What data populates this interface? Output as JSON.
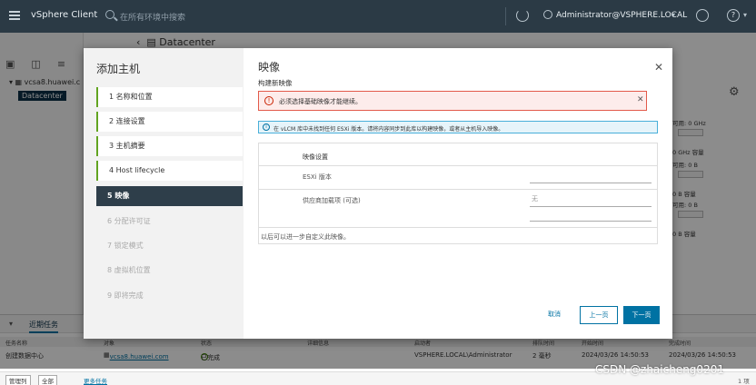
{
  "topbar": {
    "app_title": "vSphere Client",
    "search_placeholder": "在所有环境中搜索",
    "user": "Administrator@VSPHERE.LOCAL"
  },
  "background": {
    "header_title": "Datacenter",
    "tree_host": "vcsa8.huawei.c",
    "tree_datacenter": "Datacenter",
    "right_panel": {
      "cpu_free": "可用: 0 GHz",
      "cpu_capacity": "0 GHz 容量",
      "mem_free": "可用: 0 B",
      "mem_capacity": "0 B 容量",
      "storage_free": "可用: 0 B",
      "storage_capacity": "0 B 容量"
    }
  },
  "tasks": {
    "tab_recent": "近期任务",
    "columns": [
      "任务名称",
      "对象",
      "状态",
      "详细信息",
      "启动者",
      "排队时间",
      "开始时间",
      "完成时间"
    ],
    "row": {
      "name": "创建数据中心",
      "object": "vcsa8.huawei.com",
      "status": "已完成",
      "details": "",
      "initiator": "VSPHERE.LOCAL\\Administrator",
      "queued": "2 毫秒",
      "start": "2024/03/26 14:50:53",
      "end": "2024/03/26 14:50:53"
    },
    "footer": {
      "manage": "管理列",
      "filter": "全部",
      "more": "更多任务",
      "count": "1 项"
    }
  },
  "wizard": {
    "title": "添加主机",
    "steps": [
      {
        "label": "1  名称和位置",
        "state": "done"
      },
      {
        "label": "2  连接设置",
        "state": "done"
      },
      {
        "label": "3  主机摘要",
        "state": "done"
      },
      {
        "label": "4  Host lifecycle",
        "state": "done"
      },
      {
        "label": "5  映像",
        "state": "active"
      },
      {
        "label": "6  分配许可证",
        "state": "disabled"
      },
      {
        "label": "7  锁定模式",
        "state": "disabled"
      },
      {
        "label": "8  虚拟机位置",
        "state": "disabled"
      },
      {
        "label": "9  即将完成",
        "state": "disabled"
      }
    ],
    "page_title": "映像",
    "subtitle": "构建新映像",
    "error_alert": "必须选择基础映像才能继续。",
    "info_alert": "在 vLCM 库中未找到任何 ESXi 版本。请将内容同步到此库以构建映像，或者从主机导入映像。",
    "form": {
      "header": "映像设置",
      "esxi_label": "ESXi 版本",
      "esxi_value": "",
      "vendor_label": "供应商加载项 (可选)",
      "vendor_value": "无",
      "note": "以后可以进一步自定义此映像。"
    },
    "buttons": {
      "cancel": "取消",
      "back": "上一页",
      "next": "下一页"
    }
  },
  "watermark": "CSDN @zhaicheng0201",
  "colors": {
    "topbar": "#2b3a45",
    "active_step": "#2e3e4a",
    "primary": "#0072a3",
    "done_step": "#62a420",
    "error_border": "#e35a4a",
    "info_border": "#49afd9"
  }
}
